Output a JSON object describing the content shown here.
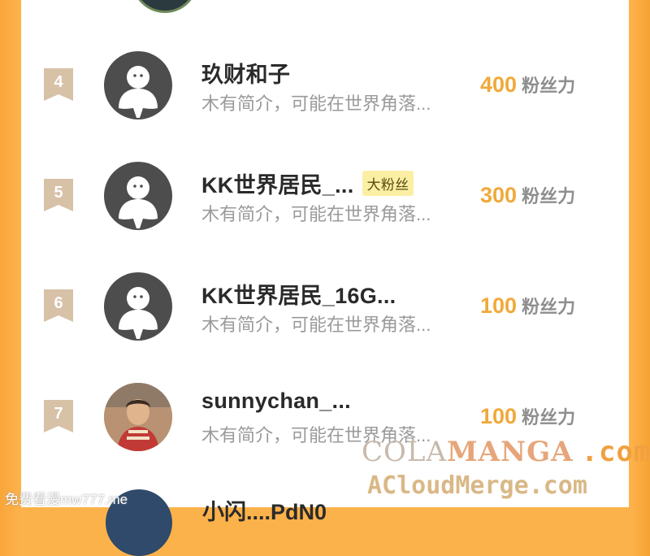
{
  "leaderboard": {
    "unit_label": "粉丝力",
    "rows": [
      {
        "rank": "4",
        "name": "玖财和子",
        "badge": "",
        "bio": "木有简介，可能在世界角落...",
        "fans": "400",
        "avatar": "default-avatar-icon"
      },
      {
        "rank": "5",
        "name": "KK世界居民_...",
        "badge": "大粉丝",
        "bio": "木有简介，可能在世界角落...",
        "fans": "300",
        "avatar": "default-avatar-icon"
      },
      {
        "rank": "6",
        "name": "KK世界居民_16G...",
        "badge": "",
        "bio": "木有简介，可能在世界角落...",
        "fans": "100",
        "avatar": "default-avatar-icon"
      },
      {
        "rank": "7",
        "name": "sunnychan_...",
        "badge": "",
        "bio": "木有简介，可能在世界角落...",
        "fans": "100",
        "avatar": "photo-avatar"
      }
    ],
    "partial_next_name": "小闪....PdN0"
  },
  "watermarks": {
    "line1_left": "COLA",
    "line1_mid": "MANGA",
    "line1_right": ".com",
    "line2": "ACloudMerge.com",
    "corner": "免费看漫mw777.me"
  },
  "colors": {
    "background": "#fcb24a",
    "fans_number": "#f0a93a",
    "rank_ribbon": "#d7c1a7",
    "badge_bg": "#fbefa4"
  }
}
